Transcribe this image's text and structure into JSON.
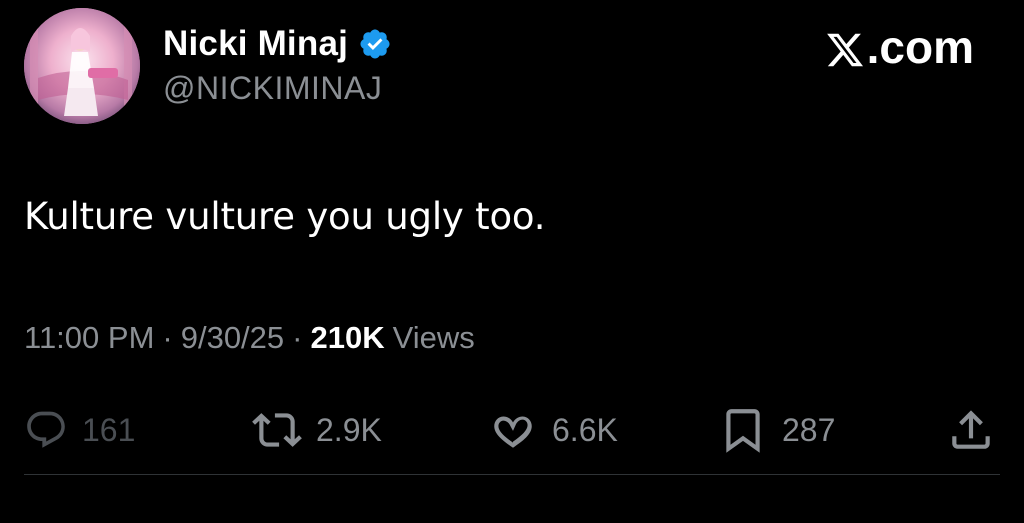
{
  "author": {
    "display_name": "Nicki Minaj",
    "handle": "@NICKIMINAJ",
    "verified_icon": "verified-badge-icon",
    "avatar_icon": "avatar"
  },
  "brand": {
    "logo_text": ".com",
    "logo_icon": "x-logo-icon"
  },
  "tweet": {
    "text": "Kulture vulture you ugly too.",
    "time": "11:00 PM",
    "date": "9/30/25",
    "views_count": "210K",
    "views_label": "Views",
    "separator": "·"
  },
  "actions": {
    "reply": {
      "icon": "reply-icon",
      "count": "161"
    },
    "repost": {
      "icon": "repost-icon",
      "count": "2.9K"
    },
    "like": {
      "icon": "heart-icon",
      "count": "6.6K"
    },
    "bookmark": {
      "icon": "bookmark-icon",
      "count": "287"
    },
    "share": {
      "icon": "share-icon"
    }
  },
  "colors": {
    "background": "#000000",
    "primary_text": "#ffffff",
    "secondary_text": "#8b8f94",
    "verified_blue": "#1d9bf0",
    "divider": "#2f3336"
  }
}
